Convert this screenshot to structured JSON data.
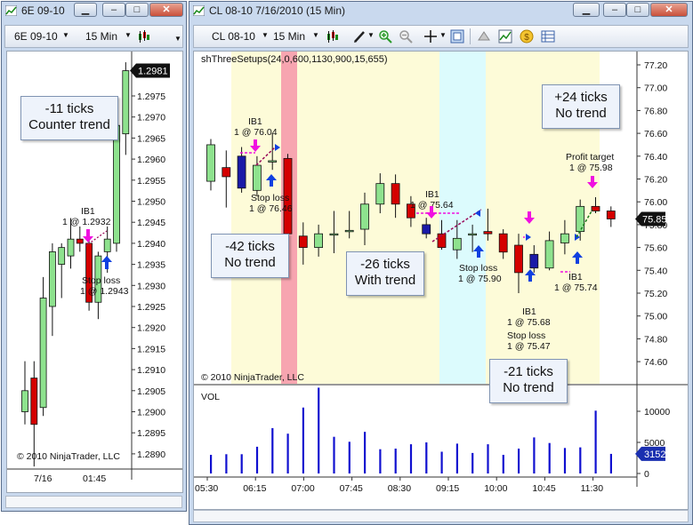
{
  "left_window": {
    "title": "6E 09-10",
    "toolbar": {
      "instrument": "6E 09-10",
      "interval": "15 Min"
    },
    "price_labels": [
      "1.2975",
      "1.2970",
      "1.2965",
      "1.2960",
      "1.2955",
      "1.2950",
      "1.2945",
      "1.2940",
      "1.2935",
      "1.2930",
      "1.2925",
      "1.2920",
      "1.2915",
      "1.2910",
      "1.2905",
      "1.2900",
      "1.2895",
      "1.2890"
    ],
    "last_price": "1.2981",
    "time_labels": [
      "7/16",
      "01:45"
    ],
    "copyright": "© 2010 NinjaTrader, LLC",
    "annotation": {
      "line1": "-11 ticks",
      "line2": "Counter trend"
    },
    "signals": {
      "ib1": "IB1",
      "ib1_fill": "1 @ 1.2932",
      "stop": "Stop loss",
      "stop_fill": "1 @ 1.2943"
    }
  },
  "right_window": {
    "title": "CL 08-10  7/16/2010 (15 Min)",
    "toolbar": {
      "instrument": "CL 08-10",
      "interval": "15 Min"
    },
    "indicator_label": "shThreeSetups(24,0,600,1130,900,15,655)",
    "price_labels": [
      "77.20",
      "77.00",
      "76.80",
      "76.60",
      "76.40",
      "76.20",
      "76.00",
      "75.80",
      "75.60",
      "75.40",
      "75.20",
      "75.00",
      "74.80",
      "74.60"
    ],
    "last_price": "75.85",
    "copyright": "© 2010 NinjaTrader, LLC",
    "volume_label": "VOL",
    "volume_ticks": [
      "10000",
      "5000",
      "0"
    ],
    "last_volume": "3152",
    "time_labels": [
      "05:30",
      "06:15",
      "07:00",
      "07:45",
      "08:30",
      "09:15",
      "10:00",
      "10:45",
      "11:30"
    ],
    "notes": [
      {
        "line1": "+24 ticks",
        "line2": "No trend"
      },
      {
        "line1": "-42 ticks",
        "line2": "No trend"
      },
      {
        "line1": "-26 ticks",
        "line2": "With trend"
      },
      {
        "line1": "-21 ticks",
        "line2": "No trend"
      }
    ],
    "signals": {
      "ib1_a": "IB1",
      "ib1_a_fill": "1 @ 76.04",
      "stop_a": "Stop loss",
      "stop_a_fill": "1 @ 76.46",
      "ib1_b": "IB1",
      "ib1_b_fill": "1 @ 75.64",
      "stop_b": "Stop loss",
      "stop_b_fill": "1 @ 75.90",
      "ib1_c": "IB1",
      "ib1_c_fill": "1 @ 75.68",
      "stop_c": "Stop loss",
      "stop_c_fill": "1 @ 75.47",
      "ib1_d": "IB1",
      "ib1_d_fill": "1 @ 75.74",
      "target": "Profit target",
      "target_fill": "1 @ 75.98"
    }
  },
  "colors": {
    "up": "#8ee28e",
    "down": "#d40000",
    "strong_down": "#1a1aa8",
    "volume": "#1010d0",
    "highlight_yellow": "#fdfbd8",
    "highlight_pink": "#f7a5b0",
    "highlight_cyan": "#dcfbfd",
    "signal_magenta": "#f010e0",
    "signal_blue": "#1040e0"
  },
  "left_candles": [
    {
      "o": 1.29,
      "h": 1.2912,
      "l": 1.2897,
      "c": 1.2905
    },
    {
      "o": 1.2908,
      "h": 1.2912,
      "l": 1.2887,
      "c": 1.2897
    },
    {
      "o": 1.2901,
      "h": 1.2932,
      "l": 1.2899,
      "c": 1.2927
    },
    {
      "o": 1.2925,
      "h": 1.294,
      "l": 1.2918,
      "c": 1.2938
    },
    {
      "o": 1.2935,
      "h": 1.294,
      "l": 1.2927,
      "c": 1.2939
    },
    {
      "o": 1.2937,
      "h": 1.2946,
      "l": 1.2934,
      "c": 1.2941
    },
    {
      "o": 1.2941,
      "h": 1.2944,
      "l": 1.2938,
      "c": 1.294
    },
    {
      "o": 1.294,
      "h": 1.2943,
      "l": 1.2924,
      "c": 1.2926
    },
    {
      "o": 1.2926,
      "h": 1.2938,
      "l": 1.2922,
      "c": 1.2937
    },
    {
      "o": 1.2938,
      "h": 1.2944,
      "l": 1.2933,
      "c": 1.2941
    },
    {
      "o": 1.294,
      "h": 1.2975,
      "l": 1.2938,
      "c": 1.2968
    },
    {
      "o": 1.2966,
      "h": 1.2983,
      "l": 1.2961,
      "c": 1.2981
    }
  ],
  "right_candles": [
    {
      "o": 76.18,
      "h": 76.55,
      "l": 76.1,
      "c": 76.5
    },
    {
      "o": 76.3,
      "h": 76.45,
      "l": 75.95,
      "c": 76.22
    },
    {
      "o": 76.4,
      "h": 76.48,
      "l": 76.08,
      "c": 76.12
    },
    {
      "o": 76.1,
      "h": 76.4,
      "l": 76.05,
      "c": 76.32
    },
    {
      "o": 76.36,
      "h": 76.6,
      "l": 76.28,
      "c": 76.36
    },
    {
      "o": 76.38,
      "h": 76.42,
      "l": 75.62,
      "c": 75.72
    },
    {
      "o": 75.7,
      "h": 75.82,
      "l": 75.45,
      "c": 75.6
    },
    {
      "o": 75.6,
      "h": 75.8,
      "l": 75.52,
      "c": 75.72
    },
    {
      "o": 75.72,
      "h": 75.92,
      "l": 75.55,
      "c": 75.72
    },
    {
      "o": 75.74,
      "h": 75.92,
      "l": 75.68,
      "c": 75.75
    },
    {
      "o": 75.76,
      "h": 76.08,
      "l": 75.62,
      "c": 75.98
    },
    {
      "o": 75.98,
      "h": 76.25,
      "l": 75.9,
      "c": 76.16
    },
    {
      "o": 76.16,
      "h": 76.24,
      "l": 75.86,
      "c": 75.98
    },
    {
      "o": 75.98,
      "h": 76.05,
      "l": 75.78,
      "c": 75.86
    },
    {
      "o": 75.8,
      "h": 75.86,
      "l": 75.68,
      "c": 75.72
    },
    {
      "o": 75.72,
      "h": 75.84,
      "l": 75.58,
      "c": 75.6
    },
    {
      "o": 75.58,
      "h": 75.84,
      "l": 75.5,
      "c": 75.68
    },
    {
      "o": 75.72,
      "h": 75.8,
      "l": 75.56,
      "c": 75.72
    },
    {
      "o": 75.74,
      "h": 75.94,
      "l": 75.66,
      "c": 75.72
    },
    {
      "o": 75.72,
      "h": 75.76,
      "l": 75.5,
      "c": 75.56
    },
    {
      "o": 75.62,
      "h": 75.72,
      "l": 75.2,
      "c": 75.38
    },
    {
      "o": 75.54,
      "h": 75.62,
      "l": 75.38,
      "c": 75.42
    },
    {
      "o": 75.42,
      "h": 75.74,
      "l": 75.4,
      "c": 75.66
    },
    {
      "o": 75.64,
      "h": 75.84,
      "l": 75.54,
      "c": 75.72
    },
    {
      "o": 75.74,
      "h": 76.02,
      "l": 75.66,
      "c": 75.96
    },
    {
      "o": 75.96,
      "h": 76.04,
      "l": 75.9,
      "c": 75.92
    },
    {
      "o": 75.92,
      "h": 75.96,
      "l": 75.78,
      "c": 75.85
    }
  ],
  "right_volume": [
    3000,
    3100,
    3100,
    4300,
    7300,
    6400,
    10600,
    13800,
    5900,
    5100,
    6700,
    3900,
    4000,
    4700,
    5000,
    3500,
    4800,
    3300,
    4700,
    3000,
    4000,
    5800,
    4900,
    4100,
    4200,
    10100,
    3152
  ]
}
